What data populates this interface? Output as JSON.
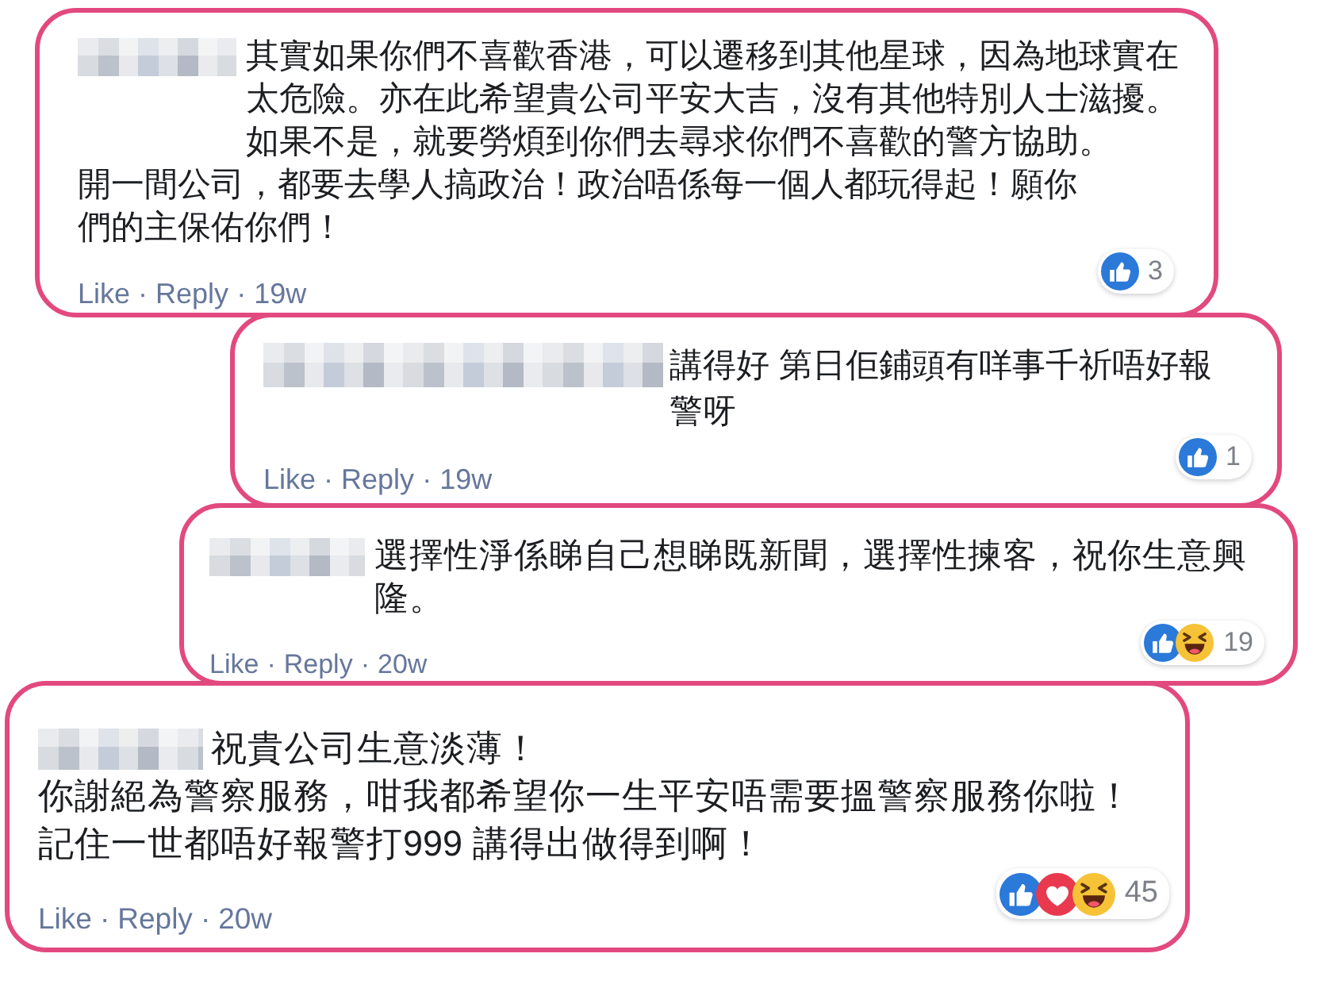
{
  "comments": [
    {
      "paragraphs": [
        "其實如果你們不喜歡香港，可以遷移到其他星球，因為地球實在太危險。亦在此希望貴公司平安大吉，沒有其他特別人士滋擾。如果不是，就要勞煩到你們去尋求你們不喜歡的警方協助。",
        "開一間公司，都要去學人搞政治！政治唔係每一個人都玩得起！願你們的主保佑你們！"
      ],
      "footer": [
        {
          "kind": "like",
          "text": "Like"
        },
        {
          "kind": "separator",
          "text": "·"
        },
        {
          "kind": "reply",
          "text": "Reply"
        },
        {
          "kind": "separator",
          "text": "·"
        },
        {
          "kind": "time",
          "text": "19w"
        }
      ],
      "reactions": [
        {
          "kind": "like"
        }
      ],
      "reaction_count": "3"
    },
    {
      "paragraphs": [
        "講得好 第日佢鋪頭有咩事千祈唔好報警呀"
      ],
      "footer": [
        {
          "kind": "like",
          "text": "Like"
        },
        {
          "kind": "separator",
          "text": "·"
        },
        {
          "kind": "reply",
          "text": "Reply"
        },
        {
          "kind": "separator",
          "text": "·"
        },
        {
          "kind": "time",
          "text": "19w"
        }
      ],
      "reactions": [
        {
          "kind": "like"
        }
      ],
      "reaction_count": "1"
    },
    {
      "paragraphs": [
        "選擇性淨係睇自己想睇既新聞，選擇性揀客，祝你生意興隆。"
      ],
      "footer": [
        {
          "kind": "like",
          "text": "Like"
        },
        {
          "kind": "separator",
          "text": "·"
        },
        {
          "kind": "reply",
          "text": "Reply"
        },
        {
          "kind": "separator",
          "text": "·"
        },
        {
          "kind": "time",
          "text": "20w"
        }
      ],
      "reactions": [
        {
          "kind": "like"
        },
        {
          "kind": "haha"
        }
      ],
      "reaction_count": "19"
    },
    {
      "paragraphs": [
        "祝貴公司生意淡薄！",
        "你謝絕為警察服務，咁我都希望你一生平安唔需要搵警察服務你啦！",
        "記住一世都唔好報警打999 講得出做得到啊！"
      ],
      "footer": [
        {
          "kind": "like",
          "text": "Like"
        },
        {
          "kind": "separator",
          "text": "·"
        },
        {
          "kind": "reply",
          "text": "Reply"
        },
        {
          "kind": "separator",
          "text": "·"
        },
        {
          "kind": "time",
          "text": "20w"
        }
      ],
      "reactions": [
        {
          "kind": "like"
        },
        {
          "kind": "love"
        },
        {
          "kind": "haha"
        }
      ],
      "reaction_count": "45"
    }
  ]
}
